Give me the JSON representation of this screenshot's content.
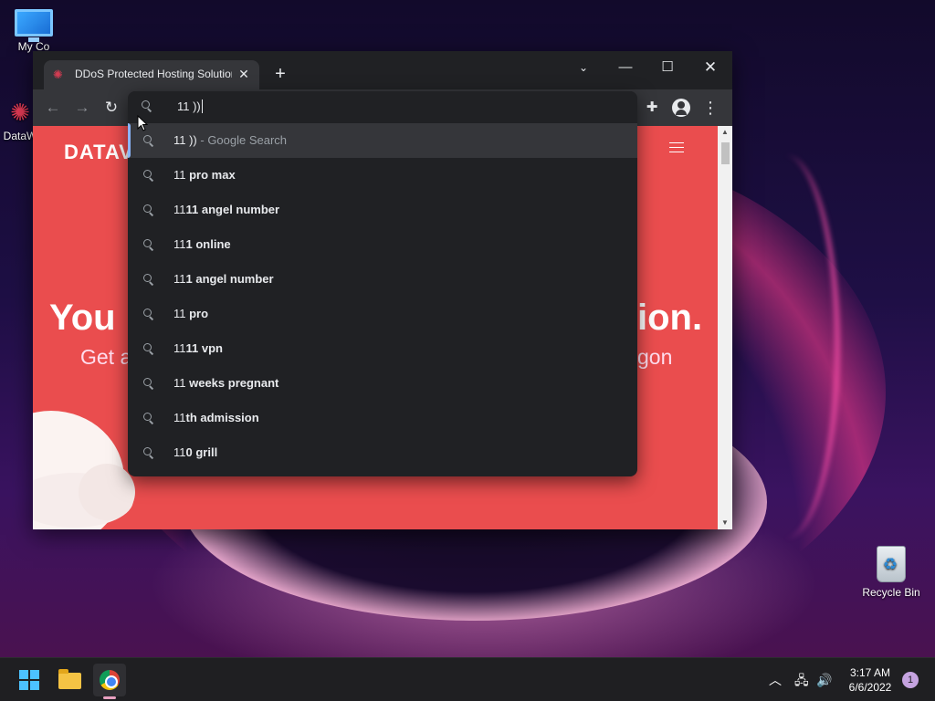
{
  "desktop": {
    "icons": {
      "my_computer": "My Co",
      "dataw": "DataW",
      "recycle_bin": "Recycle Bin"
    }
  },
  "browser": {
    "tab": {
      "title": "DDoS Protected Hosting Solution",
      "favicon": "datawagon-logo-icon"
    },
    "new_tab_label": "+",
    "window_controls": {
      "tab_search": "⌄",
      "minimize": "—",
      "maximize": "☐",
      "close": "✕"
    },
    "toolbar": {
      "back": "←",
      "forward": "→",
      "reload": "↻",
      "extensions": "✚",
      "menu": "⋮"
    },
    "omnibox": {
      "value": "11 ))",
      "suggestions": [
        {
          "typed": "11 ))",
          "rest": "",
          "sub": " - Google Search",
          "active": true
        },
        {
          "typed": "11",
          "rest": " pro max"
        },
        {
          "typed": "11",
          "rest": "11 angel number"
        },
        {
          "typed": "11",
          "rest": "1 online"
        },
        {
          "typed": "11",
          "rest": "1 angel number"
        },
        {
          "typed": "11",
          "rest": " pro"
        },
        {
          "typed": "11",
          "rest": "11 vpn"
        },
        {
          "typed": "11",
          "rest": " weeks pregnant"
        },
        {
          "typed": "11",
          "rest": "th admission"
        },
        {
          "typed": "11",
          "rest": "0 grill"
        }
      ]
    },
    "page": {
      "brand": "DATAV",
      "hero_left": "You l",
      "hero_right": "ion.",
      "sub_left": "Get a",
      "sub_right": "gon"
    }
  },
  "taskbar": {
    "clock_time": "3:17 AM",
    "clock_date": "6/6/2022",
    "notification_count": "1",
    "tray": {
      "chevron": "︿",
      "network": "🖧",
      "volume": "🔊"
    }
  },
  "colors": {
    "page_accent": "#ea4d4e",
    "chrome_dark": "#202124",
    "chrome_toolbar": "#35363a"
  }
}
